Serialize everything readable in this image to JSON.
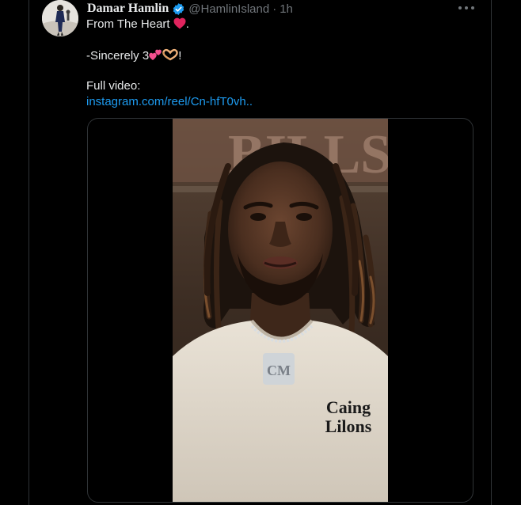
{
  "tweet": {
    "author_name": "Damar Hamlin",
    "handle": "@HamlinIsland",
    "separator": "·",
    "timestamp": "1h",
    "text_line1": "From The Heart",
    "text_line1_suffix": ".",
    "text_line2_prefix": "-Sincerely 3",
    "text_line2_suffix": "!",
    "text_line3": "Full video:",
    "link": "instagram.com/reel/Cn-hfT0vh..",
    "verified": true
  },
  "icons": {
    "verified": "verified-badge-icon",
    "more": "more-options-icon",
    "heart": "red-heart-emoji",
    "two_hearts": "two-hearts-emoji",
    "heart_hands": "heart-hands-emoji"
  },
  "colors": {
    "background": "#000000",
    "text": "#e7e9ea",
    "muted": "#71767b",
    "link": "#1d9bf0",
    "verified": "#1d9bf0",
    "border": "#2f3336"
  },
  "media": {
    "type": "video",
    "background_text": "BILLS",
    "chain_pendant_text": "CM",
    "shirt_text": [
      "Caing",
      "Lilons"
    ]
  }
}
